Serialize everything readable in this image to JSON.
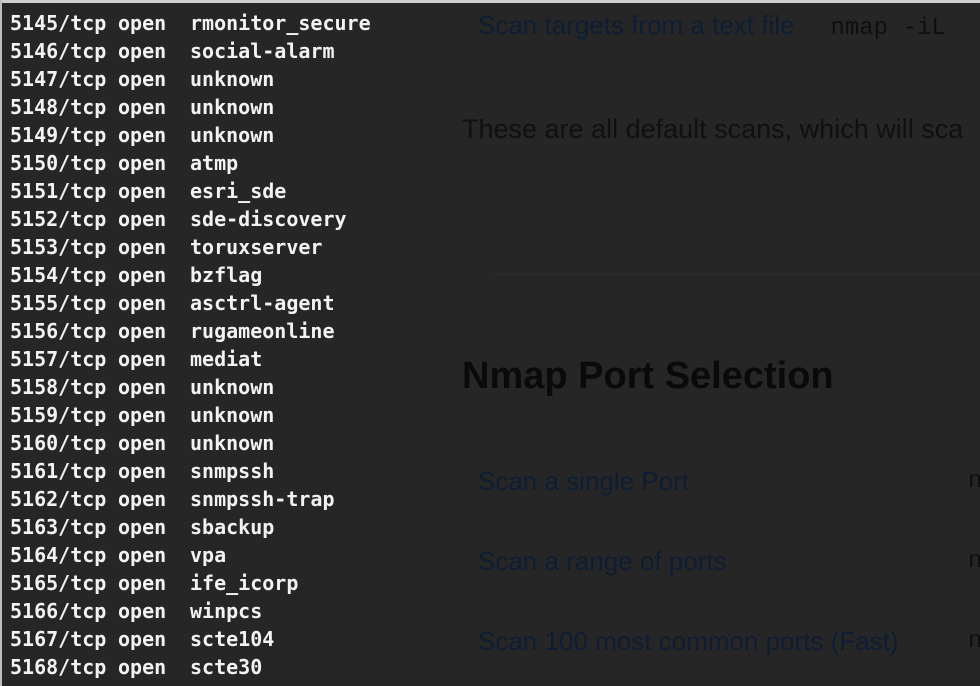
{
  "webpage": {
    "top_row": {
      "link": "Scan targets from a text file",
      "code": "nmap -iL"
    },
    "paragraph": "These are all default scans, which will sca",
    "heading": "Nmap Port Selection",
    "table": [
      {
        "label": "Scan a single Port",
        "code": "n"
      },
      {
        "label": "Scan a range of ports",
        "code": "n"
      },
      {
        "label": "Scan 100 most common ports (Fast)",
        "code": "n"
      }
    ]
  },
  "terminal": {
    "lines": [
      {
        "port": "5145/tcp",
        "state": "open",
        "service": "rmonitor_secure"
      },
      {
        "port": "5146/tcp",
        "state": "open",
        "service": "social-alarm"
      },
      {
        "port": "5147/tcp",
        "state": "open",
        "service": "unknown"
      },
      {
        "port": "5148/tcp",
        "state": "open",
        "service": "unknown"
      },
      {
        "port": "5149/tcp",
        "state": "open",
        "service": "unknown"
      },
      {
        "port": "5150/tcp",
        "state": "open",
        "service": "atmp"
      },
      {
        "port": "5151/tcp",
        "state": "open",
        "service": "esri_sde"
      },
      {
        "port": "5152/tcp",
        "state": "open",
        "service": "sde-discovery"
      },
      {
        "port": "5153/tcp",
        "state": "open",
        "service": "toruxserver"
      },
      {
        "port": "5154/tcp",
        "state": "open",
        "service": "bzflag"
      },
      {
        "port": "5155/tcp",
        "state": "open",
        "service": "asctrl-agent"
      },
      {
        "port": "5156/tcp",
        "state": "open",
        "service": "rugameonline"
      },
      {
        "port": "5157/tcp",
        "state": "open",
        "service": "mediat"
      },
      {
        "port": "5158/tcp",
        "state": "open",
        "service": "unknown"
      },
      {
        "port": "5159/tcp",
        "state": "open",
        "service": "unknown"
      },
      {
        "port": "5160/tcp",
        "state": "open",
        "service": "unknown"
      },
      {
        "port": "5161/tcp",
        "state": "open",
        "service": "snmpssh"
      },
      {
        "port": "5162/tcp",
        "state": "open",
        "service": "snmpssh-trap"
      },
      {
        "port": "5163/tcp",
        "state": "open",
        "service": "sbackup"
      },
      {
        "port": "5164/tcp",
        "state": "open",
        "service": "vpa"
      },
      {
        "port": "5165/tcp",
        "state": "open",
        "service": "ife_icorp"
      },
      {
        "port": "5166/tcp",
        "state": "open",
        "service": "winpcs"
      },
      {
        "port": "5167/tcp",
        "state": "open",
        "service": "scte104"
      },
      {
        "port": "5168/tcp",
        "state": "open",
        "service": "scte30"
      }
    ]
  }
}
